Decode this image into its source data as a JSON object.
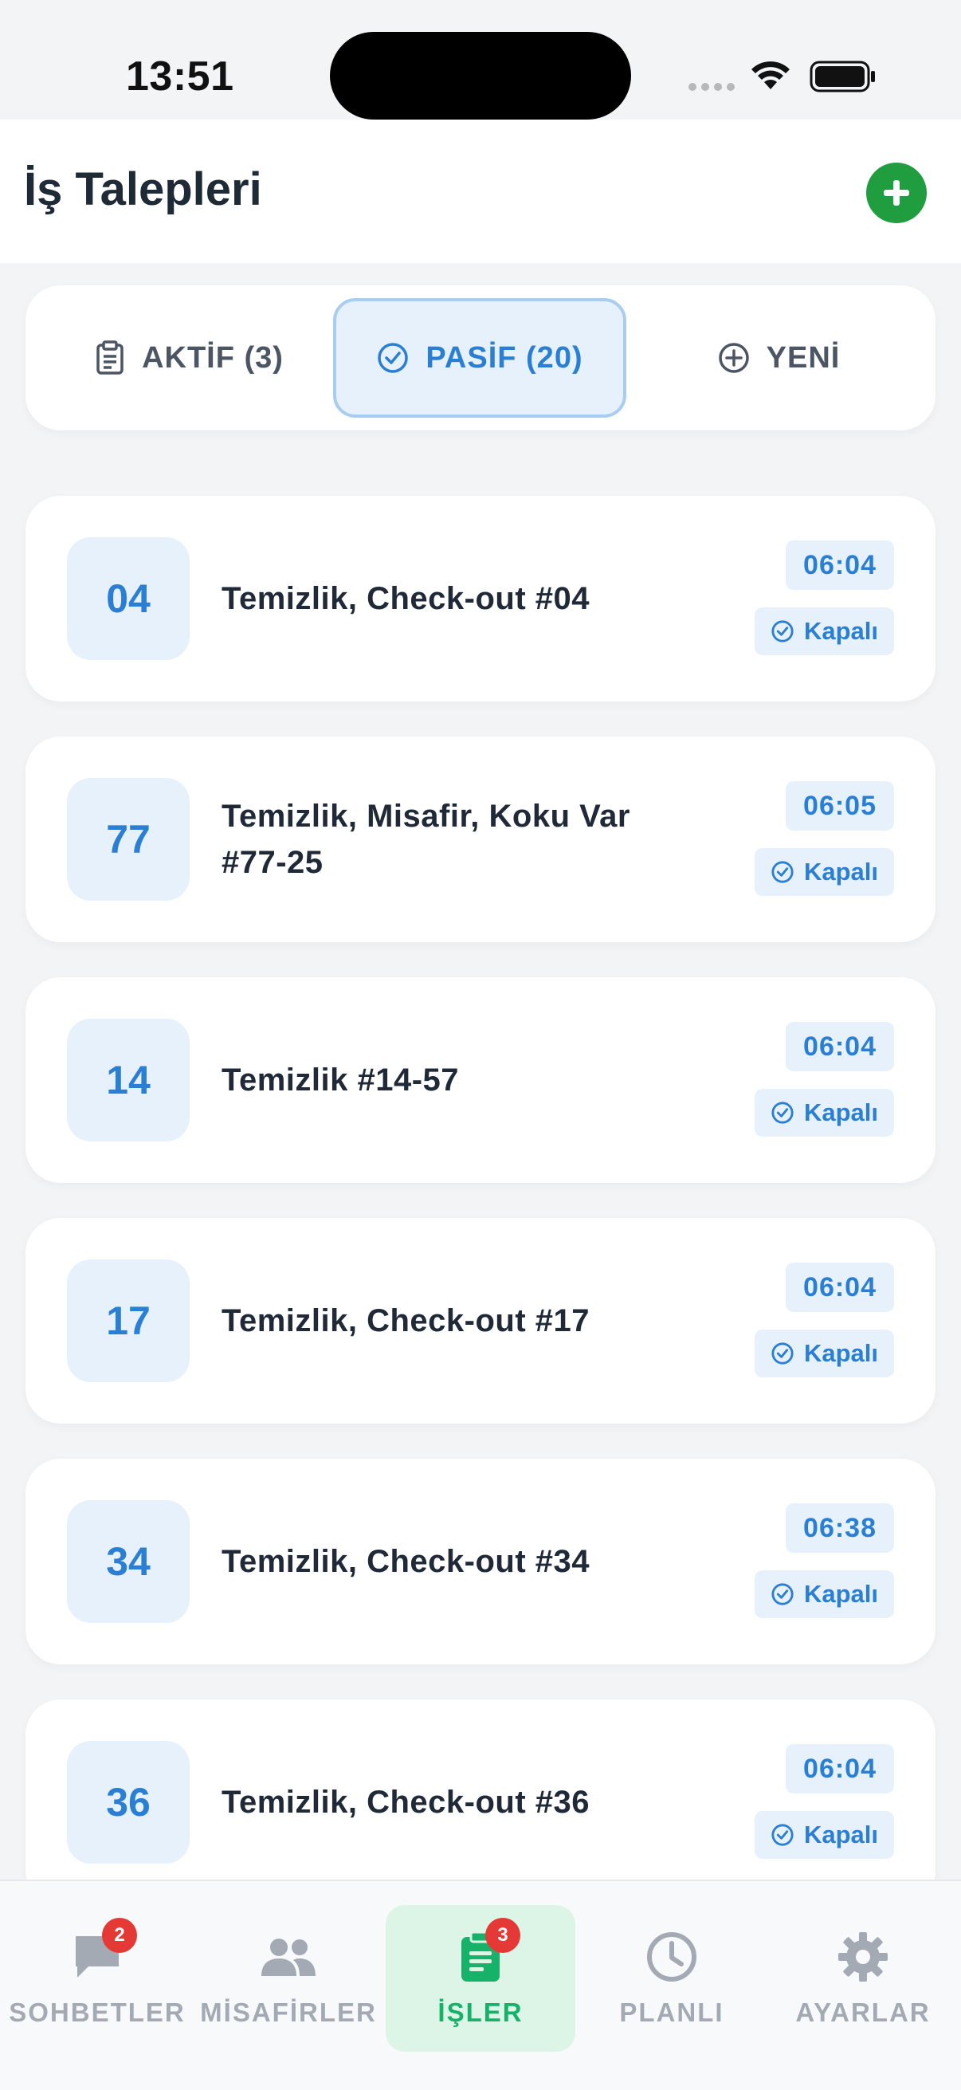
{
  "status_bar": {
    "time": "13:51"
  },
  "header": {
    "title": "İş Talepleri"
  },
  "tabs": [
    {
      "label": "AKTİF (3)",
      "icon": "clipboard-icon",
      "active": false
    },
    {
      "label": "PASİF (20)",
      "icon": "check-circle-icon",
      "active": true
    },
    {
      "label": "YENİ",
      "icon": "plus-circle-icon",
      "active": false
    }
  ],
  "jobs": [
    {
      "room": "04",
      "title": "Temizlik, Check-out #04",
      "time": "06:04",
      "status": "Kapalı"
    },
    {
      "room": "77",
      "title": "Temizlik, Misafir, Koku Var #77-25",
      "time": "06:05",
      "status": "Kapalı"
    },
    {
      "room": "14",
      "title": "Temizlik #14-57",
      "time": "06:04",
      "status": "Kapalı"
    },
    {
      "room": "17",
      "title": "Temizlik, Check-out #17",
      "time": "06:04",
      "status": "Kapalı"
    },
    {
      "room": "34",
      "title": "Temizlik, Check-out #34",
      "time": "06:38",
      "status": "Kapalı"
    },
    {
      "room": "36",
      "title": "Temizlik, Check-out #36",
      "time": "06:04",
      "status": "Kapalı"
    }
  ],
  "bottom_nav": [
    {
      "label": "SOHBETLER",
      "icon": "chat-bubble-icon",
      "badge": "2",
      "active": false
    },
    {
      "label": "MİSAFİRLER",
      "icon": "people-icon",
      "badge": null,
      "active": false
    },
    {
      "label": "İŞLER",
      "icon": "clipboard-icon",
      "badge": "3",
      "active": true
    },
    {
      "label": "PLANLI",
      "icon": "clock-icon",
      "badge": null,
      "active": false
    },
    {
      "label": "AYARLAR",
      "icon": "gear-icon",
      "badge": null,
      "active": false
    }
  ],
  "colors": {
    "accent_blue": "#2a7fd4",
    "accent_green": "#17b26a",
    "add_button": "#1f9d3f",
    "badge_red": "#e53935"
  }
}
